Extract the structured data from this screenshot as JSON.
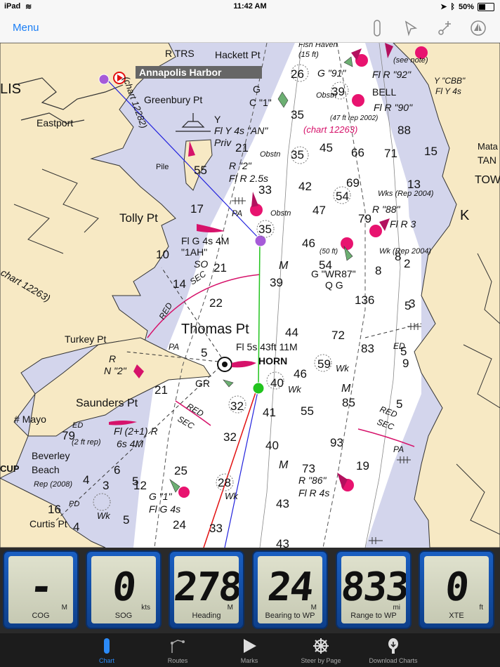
{
  "status_bar": {
    "device": "iPad",
    "time": "11:42 AM",
    "battery": "50%",
    "battery_level": 0.5
  },
  "nav_bar": {
    "menu_label": "Menu"
  },
  "map": {
    "labels": {
      "annapolis_harbor": "Annapolis Harbor",
      "thomas_pt": "Thomas Pt",
      "tolly_pt": "Tolly Pt",
      "turkey_pt": "Turkey Pt",
      "saunders_pt": "Saunders Pt",
      "greenbury_pt": "Greenbury Pt",
      "hackett_pt": "Hackett Pt",
      "eastport": "Eastport",
      "mayo": "# Mayo",
      "beverley_beach": "Beverley\nBeach",
      "curtis_pt": "Curtis Pt",
      "lis": "LIS",
      "rtrs": "R TRS",
      "chart_12263_a": "(chart 12263)",
      "chart_12263_b": "chart 12263)",
      "chart_12282": "(chart 12282)",
      "light_main": "Fl 5s 43ft 11M",
      "horn": "HORN",
      "fl_g_4s_4m": "Fl G 4s 4M",
      "one_ah": "\"1AH\"",
      "fl_r_25s": "Fl R 2.5s",
      "r2": "R \"2\"",
      "fly_4s_an": "Fl Y 4s \"AN\"",
      "priv": "Priv",
      "obstn": "Obstn",
      "wks_rep": "Wks (Rep 2004)",
      "r88": "R \"88\"",
      "fl_r_3": "Fl R 3",
      "wk_rep_2004": "Wk (Rep 2004)",
      "g_wr87": "G \"WR87\"",
      "qg": "Q G",
      "r86": "R \"86\"",
      "fl_r_4s": "Fl R 4s",
      "fl_21_r": "Fl (2+1) R",
      "six_s_4m": "6s 4M",
      "g1": "G \"1\"",
      "fl_g_4s": "Fl G 4s",
      "n2": "N \"2\"",
      "fish_haven": "Fish Haven",
      "fifteen_ft": "(15 ft)",
      "fl_r_92": "Fl R \"92\"",
      "bell": "BELL",
      "fl_r_90": "Fl R \"90\"",
      "ycbb": "Y \"CBB\"",
      "fl_y_4s": "Fl Y 4s",
      "see_note": "(see note)",
      "g91": "G \"91\"",
      "tower": "TOWER",
      "matapeake": "Mata",
      "tan": "TAN",
      "k": "K",
      "sec": "SEC",
      "red": "RED",
      "gr": "GR",
      "wk": "Wk",
      "pa": "PA",
      "m": "M",
      "so": "SO",
      "cup": "CUP",
      "ed": "ED",
      "two_ft_rep": "(2 ft rep)",
      "rep_2008": "Rep (2008)",
      "pd": "PD",
      "fifty_ft": "(50 ft)",
      "forty7_ft": "(47 ft rep 2002)",
      "r_letter": "R",
      "g_letter": "G",
      "c_1": "C \"1\"",
      "pile": "Pile",
      "y": "Y",
      "gt": "GR",
      "c": "C"
    },
    "soundings": [
      "26",
      "39",
      "35",
      "88",
      "35",
      "45",
      "66",
      "71",
      "15",
      "21",
      "33",
      "42",
      "69",
      "54",
      "13",
      "47",
      "79",
      "35",
      "46",
      "54",
      "8",
      "10",
      "21",
      "39",
      "14",
      "22",
      "136",
      "3",
      "44",
      "72",
      "83",
      "5",
      "5",
      "59",
      "46",
      "40",
      "85",
      "21",
      "32",
      "41",
      "55",
      "93",
      "5",
      "32",
      "40",
      "19",
      "25",
      "73",
      "28",
      "43",
      "12",
      "33",
      "24",
      "43",
      "55",
      "17",
      "8",
      "79",
      "2",
      "4",
      "6",
      "16",
      "4",
      "9",
      "5",
      "3",
      "5",
      "5"
    ]
  },
  "instruments": [
    {
      "value": "-",
      "unit": "M",
      "label": "COG"
    },
    {
      "value": "0",
      "unit": "kts",
      "label": "SOG"
    },
    {
      "value": "278",
      "unit": "M",
      "label": "Heading"
    },
    {
      "value": "24",
      "unit": "M",
      "label": "Bearing to WP"
    },
    {
      "value": "833",
      "unit": "mi",
      "label": "Range to WP"
    },
    {
      "value": "0",
      "unit": "ft",
      "label": "XTE"
    }
  ],
  "tab_bar": {
    "tabs": [
      {
        "label": "Chart",
        "icon": "chart-icon",
        "active": true
      },
      {
        "label": "Routes",
        "icon": "routes-icon",
        "active": false
      },
      {
        "label": "Marks",
        "icon": "marks-icon",
        "active": false
      },
      {
        "label": "Steer by Page",
        "icon": "steer-wheel-icon",
        "active": false
      },
      {
        "label": "Download Charts",
        "icon": "download-charts-icon",
        "active": false
      }
    ]
  },
  "colors": {
    "land": "#f7e9c4",
    "shallow_water": "#d3d5ec",
    "deep_water": "#ffffff",
    "accent": "#1a7ef5",
    "magenta": "#d6126a",
    "waypoint_purple": "#a65bd8",
    "waypoint_green": "#22c41e"
  }
}
